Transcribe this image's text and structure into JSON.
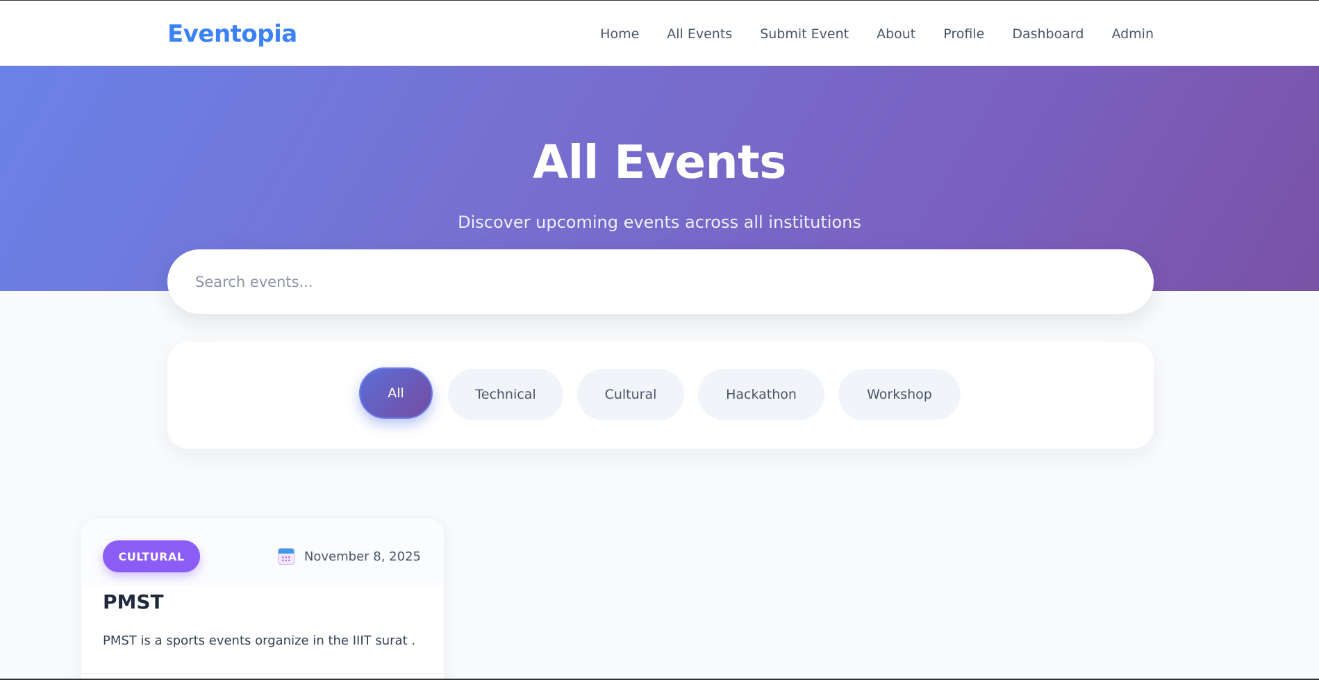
{
  "nav": {
    "logo": "Eventopia",
    "links": [
      "Home",
      "All Events",
      "Submit Event",
      "About",
      "Profile",
      "Dashboard",
      "Admin"
    ]
  },
  "hero": {
    "title": "All Events",
    "subtitle": "Discover upcoming events across all institutions"
  },
  "search": {
    "placeholder": "Search events..."
  },
  "filters": {
    "chips": [
      "All",
      "Technical",
      "Cultural",
      "Hackathon",
      "Workshop"
    ],
    "selected": "All"
  },
  "events": [
    {
      "category": "CULTURAL",
      "date": "November 8, 2025",
      "title": "PMST",
      "description": "PMST is a sports events organize in the IIIT surat ."
    }
  ],
  "colors": {
    "brand": "#3b82f6",
    "accent_gradient_start": "#667eea",
    "accent_gradient_end": "#764ba2",
    "category_cultural": "#8b5cf6"
  },
  "icons": {
    "date": "calendar-icon"
  }
}
